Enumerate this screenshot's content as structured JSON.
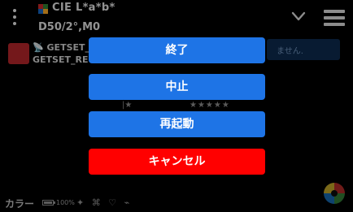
{
  "header": {
    "color_space_title": "CIE L*a*b*",
    "color_space_sub": "D50/2°,M0",
    "swatch_colors": [
      "#c62828",
      "#2e7d32",
      "#1565c0",
      "#f9a825"
    ]
  },
  "background": {
    "message_line1": "📡 GETSET_I",
    "message_line2": "GETSET_RE",
    "message_right": "ません.",
    "marker_text": "|★",
    "stars_text": "★★★★★"
  },
  "footer": {
    "label": "カラー",
    "battery_level": "100%",
    "icons": [
      "✦",
      "⌘",
      "♡",
      "⌁"
    ]
  },
  "dialog": {
    "exit_label": "終了",
    "stop_label": "中止",
    "restart_label": "再起動",
    "cancel_label": "キャンセル"
  },
  "colors": {
    "button_blue": "#1e74e6",
    "button_red": "#ff0000",
    "background": "#000000"
  }
}
